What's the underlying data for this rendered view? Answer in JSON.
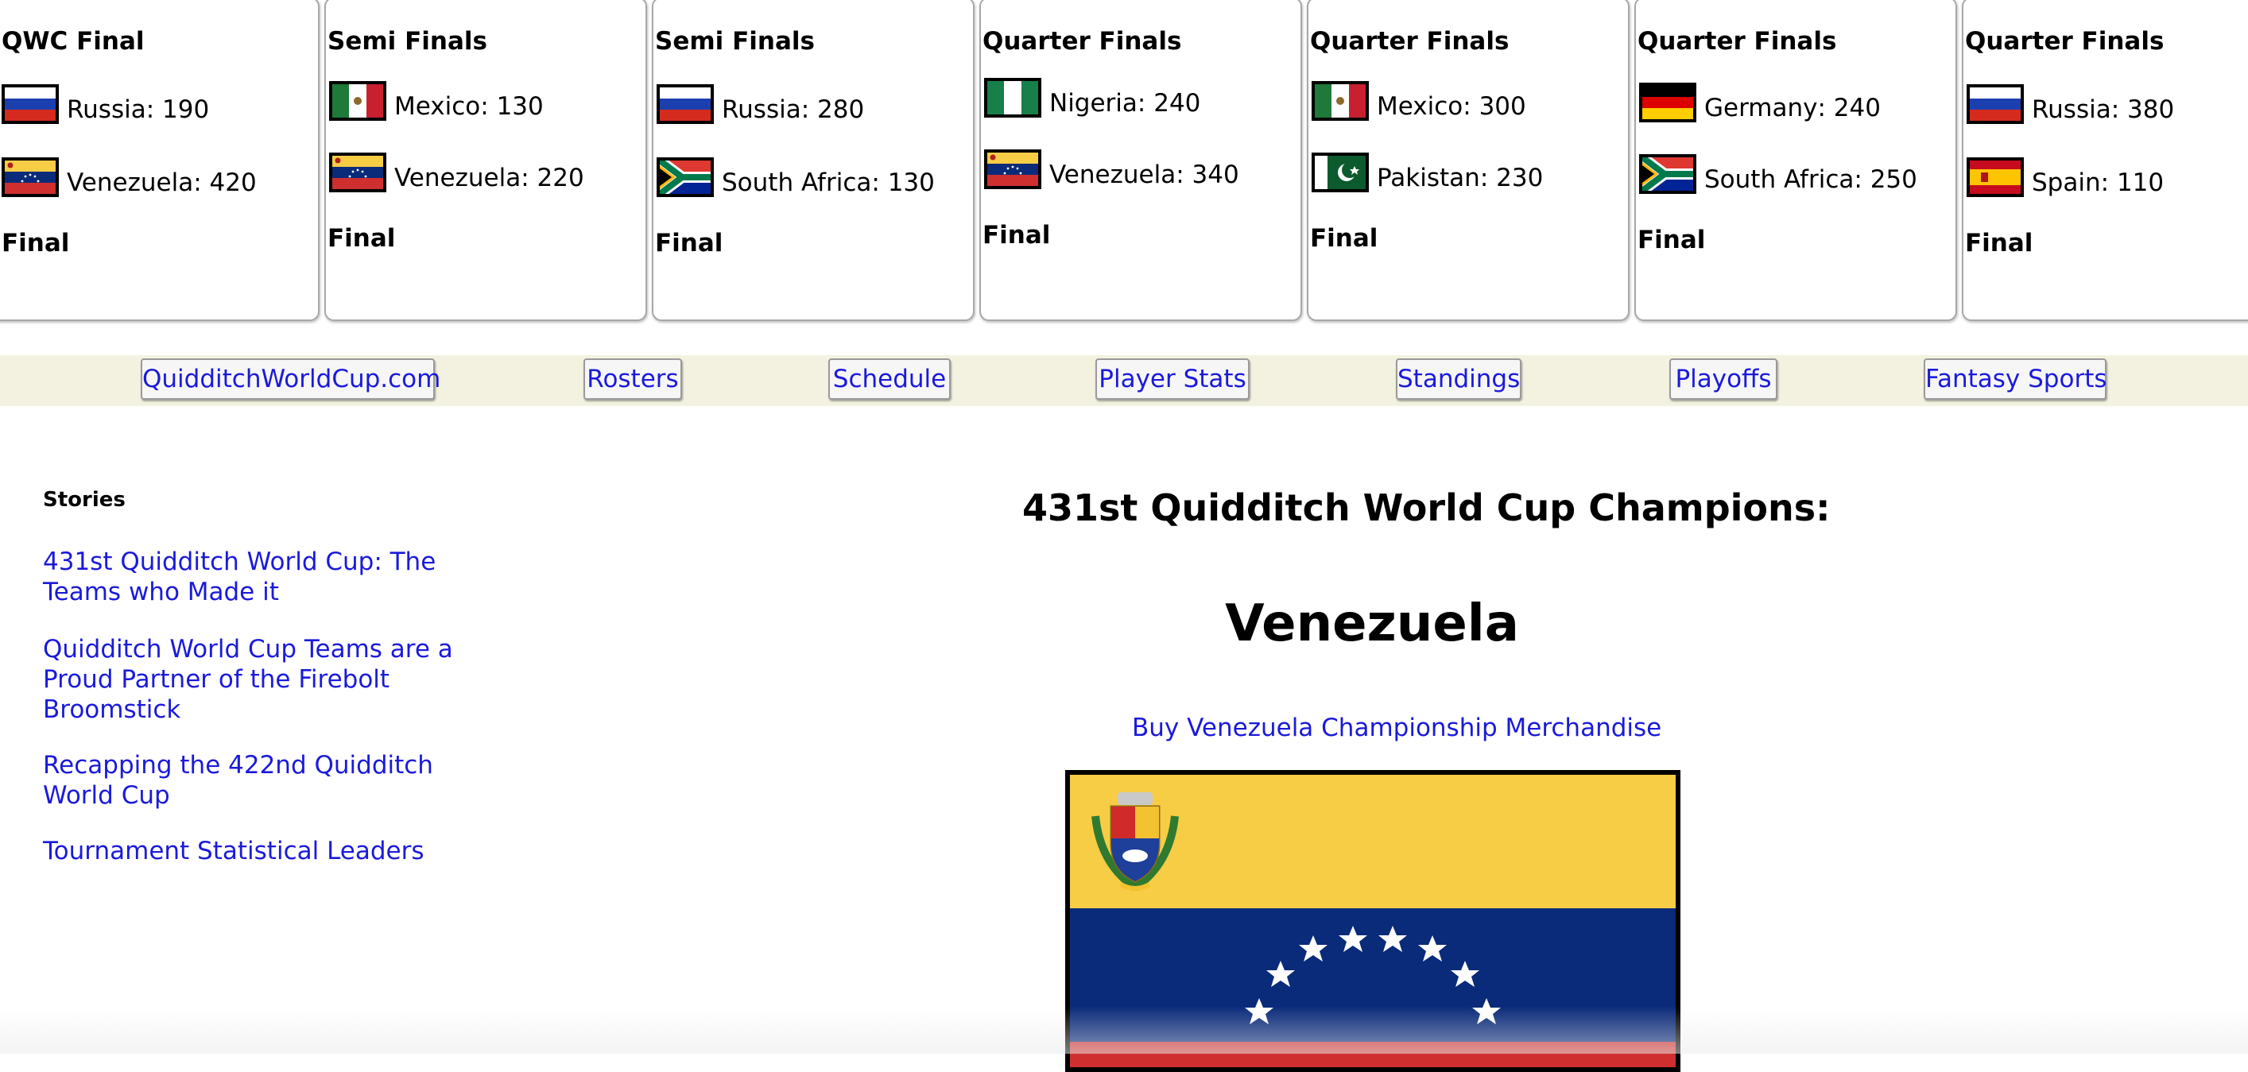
{
  "scoreboard": [
    {
      "round": "QWC Final",
      "teams": [
        {
          "name": "Russia",
          "score": "190",
          "flag": "russia"
        },
        {
          "name": "Venezuela",
          "score": "420",
          "flag": "venezuela"
        }
      ],
      "status": "Final"
    },
    {
      "round": "Semi Finals",
      "teams": [
        {
          "name": "Mexico",
          "score": "130",
          "flag": "mexico"
        },
        {
          "name": "Venezuela",
          "score": "220",
          "flag": "venezuela"
        }
      ],
      "status": "Final"
    },
    {
      "round": "Semi Finals",
      "teams": [
        {
          "name": "Russia",
          "score": "280",
          "flag": "russia"
        },
        {
          "name": "South Africa",
          "score": "130",
          "flag": "south-africa"
        }
      ],
      "status": "Final"
    },
    {
      "round": "Quarter Finals",
      "teams": [
        {
          "name": "Nigeria",
          "score": "240",
          "flag": "nigeria"
        },
        {
          "name": "Venezuela",
          "score": "340",
          "flag": "venezuela"
        }
      ],
      "status": "Final"
    },
    {
      "round": "Quarter Finals",
      "teams": [
        {
          "name": "Mexico",
          "score": "300",
          "flag": "mexico"
        },
        {
          "name": "Pakistan",
          "score": "230",
          "flag": "pakistan"
        }
      ],
      "status": "Final"
    },
    {
      "round": "Quarter Finals",
      "teams": [
        {
          "name": "Germany",
          "score": "240",
          "flag": "germany"
        },
        {
          "name": "South Africa",
          "score": "250",
          "flag": "south-africa"
        }
      ],
      "status": "Final"
    },
    {
      "round": "Quarter Finals",
      "teams": [
        {
          "name": "Russia",
          "score": "380",
          "flag": "russia"
        },
        {
          "name": "Spain",
          "score": "110",
          "flag": "spain"
        }
      ],
      "status": "Final"
    }
  ],
  "nav": {
    "items": [
      {
        "label": "QuidditchWorldCup.com"
      },
      {
        "label": "Rosters"
      },
      {
        "label": "Schedule"
      },
      {
        "label": "Player Stats"
      },
      {
        "label": "Standings"
      },
      {
        "label": "Playoffs"
      },
      {
        "label": "Fantasy Sports"
      }
    ]
  },
  "sidebar": {
    "title": "Stories",
    "stories": [
      {
        "label": "431st Quidditch World Cup: The Teams who Made it"
      },
      {
        "label": "Quidditch World Cup Teams are a Proud Partner of the Firebolt Broomstick"
      },
      {
        "label": "Recapping the 422nd Quidditch World Cup"
      },
      {
        "label": "Tournament Statistical Leaders"
      }
    ]
  },
  "main": {
    "heading": "431st Quidditch World Cup Champions:",
    "champion": "Venezuela",
    "merch_link": "Buy Venezuela Championship Merchandise",
    "flag": "venezuela"
  },
  "colors": {
    "link": "#1a1adb",
    "navbar_bg": "#f3f2e0",
    "card_border": "#a8a8a8"
  }
}
